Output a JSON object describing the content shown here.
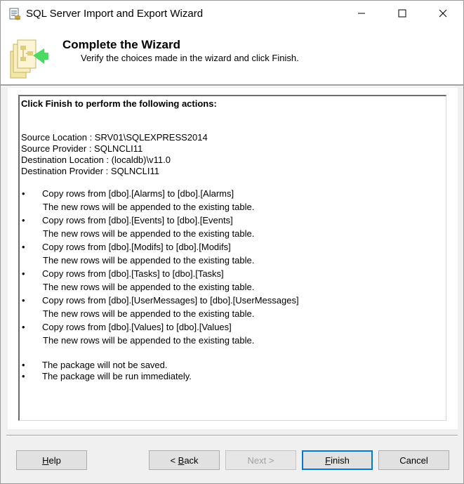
{
  "window": {
    "title": "SQL Server Import and Export Wizard"
  },
  "icons": {
    "app": "sql-wizard-icon",
    "minimize": "minimize-icon",
    "maximize": "maximize-icon",
    "close": "close-icon",
    "header": "wizard-header-icon"
  },
  "header": {
    "title": "Complete the Wizard",
    "subtitle": "Verify the choices made in the wizard and click Finish."
  },
  "report": {
    "heading": "Click Finish to perform the following actions:",
    "details": [
      "Source Location : SRV01\\SQLEXPRESS2014",
      "Source Provider : SQLNCLI11",
      "Destination Location : (localdb)\\v11.0",
      "Destination Provider : SQLNCLI11"
    ],
    "bullet": "•",
    "copy_items": [
      {
        "action": "Copy rows from [dbo].[Alarms] to [dbo].[Alarms]",
        "note": "The new rows will be appended to the existing table."
      },
      {
        "action": "Copy rows from [dbo].[Events] to [dbo].[Events]",
        "note": "The new rows will be appended to the existing table."
      },
      {
        "action": "Copy rows from [dbo].[Modifs] to [dbo].[Modifs]",
        "note": "The new rows will be appended to the existing table."
      },
      {
        "action": "Copy rows from [dbo].[Tasks] to [dbo].[Tasks]",
        "note": "The new rows will be appended to the existing table."
      },
      {
        "action": "Copy rows from [dbo].[UserMessages] to [dbo].[UserMessages]",
        "note": "The new rows will be appended to the existing table."
      },
      {
        "action": "Copy rows from [dbo].[Values] to [dbo].[Values]",
        "note": "The new rows will be appended to the existing table."
      }
    ],
    "package_items": [
      "The package will not be saved.",
      "The package will be run immediately."
    ]
  },
  "buttons": {
    "help": {
      "mnemonic": "H",
      "rest": "elp"
    },
    "back": {
      "prefix": "< ",
      "mnemonic": "B",
      "rest": "ack"
    },
    "next": {
      "label": "Next >",
      "disabled": true
    },
    "finish": {
      "mnemonic": "F",
      "rest": "inish"
    },
    "cancel": {
      "label": "Cancel"
    }
  },
  "colors": {
    "window_bg": "#f0f0f0",
    "default_button_border": "#0078d7",
    "wizard_icon_arrow": "#4cd964"
  }
}
